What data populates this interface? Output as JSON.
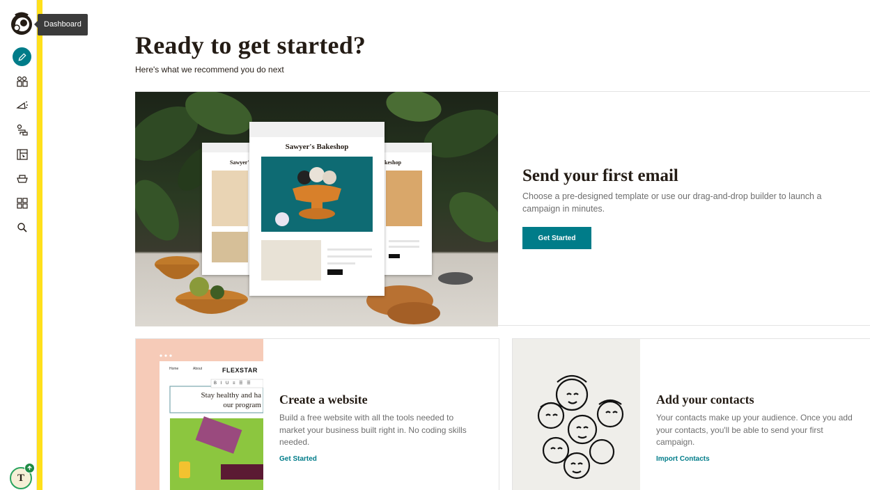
{
  "sidebar": {
    "tooltip": "Dashboard",
    "avatar_initial": "T",
    "items": [
      {
        "name": "create",
        "icon": "pencil-icon"
      },
      {
        "name": "audience",
        "icon": "audience-icon"
      },
      {
        "name": "campaigns",
        "icon": "megaphone-icon"
      },
      {
        "name": "automations",
        "icon": "automation-icon"
      },
      {
        "name": "website",
        "icon": "website-icon"
      },
      {
        "name": "integrations",
        "icon": "integrations-icon"
      },
      {
        "name": "content",
        "icon": "grid-icon"
      },
      {
        "name": "search",
        "icon": "search-icon"
      }
    ]
  },
  "main": {
    "title": "Ready to get started?",
    "subtitle": "Here's what we recommend you do next",
    "hero": {
      "title": "Send your first email",
      "description": "Choose a pre-designed template or use our drag-and-drop builder to launch a campaign in minutes.",
      "button_label": "Get Started",
      "mock_brand": "Sawyer's Bakeshop",
      "mock_left_brand": "Sawyer'",
      "mock_right_brand": "akeshop"
    },
    "cards": [
      {
        "title": "Create a website",
        "description": "Build a free website with all the tools needed to market your business built right in. No coding skills needed.",
        "link_label": "Get Started",
        "mock_nav_home": "Home",
        "mock_nav_about": "About",
        "mock_brand": "FLEXSTAR",
        "mock_headline": "Stay healthy and ha our program"
      },
      {
        "title": "Add your contacts",
        "description": "Your contacts make up your audience. Once you add your contacts, you'll be able to send your first campaign.",
        "link_label": "Import Contacts"
      }
    ]
  },
  "colors": {
    "accent": "#007c89",
    "rail": "#ffe01b",
    "avatar_badge": "#1e8a44"
  }
}
